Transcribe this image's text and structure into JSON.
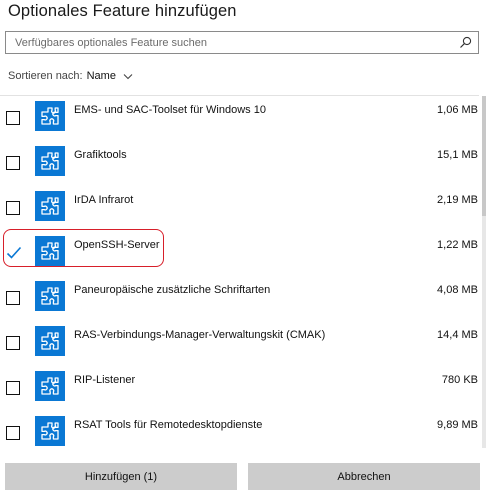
{
  "dialog": {
    "title": "Optionales Feature hinzufügen",
    "search": {
      "placeholder": "Verfügbares optionales Feature suchen",
      "value": ""
    },
    "sort": {
      "label": "Sortieren nach:",
      "value": "Name"
    }
  },
  "features": [
    {
      "name": "EMS- und SAC-Toolset für Windows 10",
      "size": "1,06 MB",
      "checked": false
    },
    {
      "name": "Grafiktools",
      "size": "15,1 MB",
      "checked": false
    },
    {
      "name": "IrDA Infrarot",
      "size": "2,19 MB",
      "checked": false
    },
    {
      "name": "OpenSSH-Server",
      "size": "1,22 MB",
      "checked": true
    },
    {
      "name": "Paneuropäische zusätzliche Schriftarten",
      "size": "4,08 MB",
      "checked": false
    },
    {
      "name": "RAS-Verbindungs-Manager-Verwaltungskit (CMAK)",
      "size": "14,4 MB",
      "checked": false
    },
    {
      "name": "RIP-Listener",
      "size": "780 KB",
      "checked": false
    },
    {
      "name": "RSAT Tools für Remotedesktopdienste",
      "size": "9,89 MB",
      "checked": false
    }
  ],
  "buttons": {
    "add": "Hinzufügen (1)",
    "cancel": "Abbrechen"
  },
  "colors": {
    "accent": "#0a78d4",
    "highlight": "#d71f2a",
    "button": "#cccccc"
  },
  "icons": {
    "feature": "puzzle-icon",
    "search": "search-icon",
    "sort": "chevron-down-icon",
    "check": "checkmark-icon"
  }
}
